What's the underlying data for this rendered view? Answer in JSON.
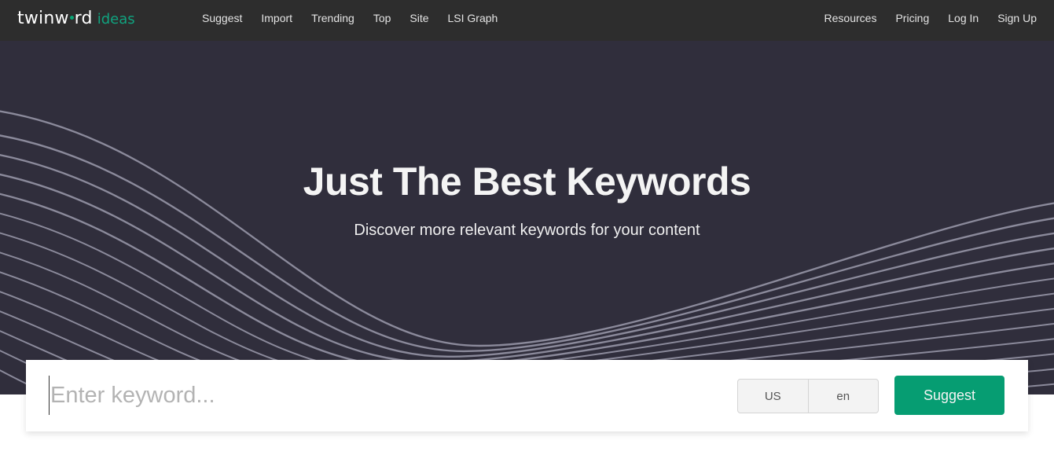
{
  "brand": {
    "logo_main_before_dot": "twinw",
    "logo_main_after_dot": "rd",
    "logo_sub": "ideas",
    "accent_color": "#0aa575"
  },
  "nav": {
    "left": [
      {
        "label": "Suggest"
      },
      {
        "label": "Import"
      },
      {
        "label": "Trending"
      },
      {
        "label": "Top"
      },
      {
        "label": "Site"
      },
      {
        "label": "LSI Graph"
      }
    ],
    "right": [
      {
        "label": "Resources"
      },
      {
        "label": "Pricing"
      },
      {
        "label": "Log In"
      },
      {
        "label": "Sign Up"
      }
    ]
  },
  "hero": {
    "title": "Just The Best Keywords",
    "subtitle": "Discover more relevant keywords for your content",
    "background_color": "#302e3c",
    "wave_color": "#8b8a9b"
  },
  "search": {
    "placeholder": "Enter keyword...",
    "value": "",
    "country": "US",
    "language": "en",
    "submit_label": "Suggest",
    "submit_color": "#069d72"
  }
}
